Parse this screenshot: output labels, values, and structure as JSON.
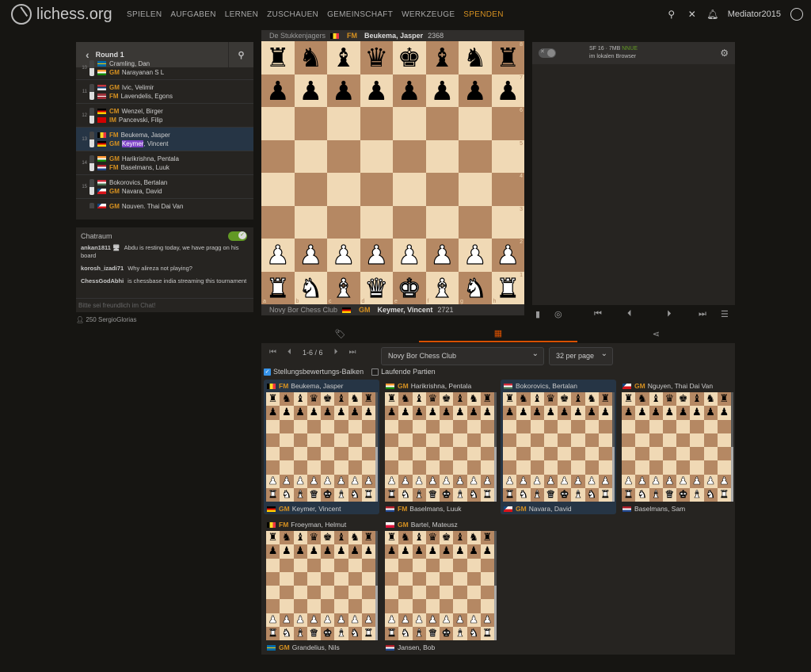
{
  "brand": {
    "name": "lichess.org"
  },
  "nav": [
    "SPIELEN",
    "AUFGABEN",
    "LERNEN",
    "ZUSCHAUEN",
    "GEMEINSCHAFT",
    "WERKZEUGE",
    "SPENDEN"
  ],
  "user": {
    "name": "Mediator2015"
  },
  "relay": {
    "round": "Round 1",
    "games": [
      {
        "num": "10",
        "white": {
          "title": "",
          "name": "Cramling, Dan",
          "flag": "se"
        },
        "black": {
          "title": "GM",
          "name": "Narayanan S L",
          "flag": "in"
        }
      },
      {
        "num": "11",
        "white": {
          "title": "GM",
          "name": "Ivic, Velimir",
          "flag": "rs"
        },
        "black": {
          "title": "FM",
          "name": "Lavendelis, Egons",
          "flag": "lv"
        }
      },
      {
        "num": "12",
        "white": {
          "title": "CM",
          "name": "Wenzel, Birger",
          "flag": "de"
        },
        "black": {
          "title": "IM",
          "name": "Pancevski, Filip",
          "flag": "mk"
        }
      },
      {
        "num": "13",
        "white": {
          "title": "FM",
          "name": "Beukema, Jasper",
          "flag": "be"
        },
        "black": {
          "title": "GM",
          "name_hl": "Keymer",
          "name_rest": ", Vincent",
          "flag": "de"
        },
        "selected": true
      },
      {
        "num": "14",
        "white": {
          "title": "GM",
          "name": "Harikrishna, Pentala",
          "flag": "in"
        },
        "black": {
          "title": "FM",
          "name": "Baselmans, Luuk",
          "flag": "nl"
        }
      },
      {
        "num": "15",
        "white": {
          "title": "",
          "name": "Bokorovics, Bertalan",
          "flag": "hu"
        },
        "black": {
          "title": "GM",
          "name": "Navara, David",
          "flag": "cz"
        }
      },
      {
        "num": "16",
        "white": {
          "title": "GM",
          "name": "Nguyen, Thai Dai Van",
          "flag": "cz"
        },
        "black": {
          "title": "",
          "name": "Baselmans, Sam",
          "flag": "nl"
        }
      }
    ]
  },
  "chat": {
    "title": "Chatraum",
    "messages": [
      {
        "user": "ankan1811 🖥",
        "text": "Abdu is resting today, we have pragg on his board"
      },
      {
        "user": "korosh_izadi71",
        "text": "Why alireza not playing?"
      },
      {
        "user": "ChessGodAbhi",
        "text": "is chessbase india streaming this tournament"
      }
    ],
    "placeholder": "Bitte sei freundlich im Chat!"
  },
  "spectators": {
    "count": "250",
    "names": "SergioGlorias"
  },
  "board": {
    "top": {
      "team": "De Stukkenjagers",
      "title": "FM",
      "name": "Beukema, Jasper",
      "rating": "2368",
      "flag": "be"
    },
    "bottom": {
      "team": "Novy Bor Chess Club",
      "title": "GM",
      "name": "Keymer, Vincent",
      "rating": "2721",
      "flag": "de"
    },
    "ranks": [
      "8",
      "7",
      "6",
      "5",
      "4",
      "3",
      "2",
      "1"
    ],
    "files": [
      "a",
      "b",
      "c",
      "d",
      "e",
      "f",
      "g",
      "h"
    ]
  },
  "engine": {
    "name": "SF 16 · 7MB",
    "nnue": "NNUE",
    "location": "im lokalen Browser"
  },
  "multiboard": {
    "pager": "1-6 / 6",
    "team_select": "Novy Bor Chess Club",
    "per_page": "32 per page",
    "eval_bars_label": "Stellungsbewertungs-Balken",
    "ongoing_label": "Laufende Partien",
    "games": [
      {
        "top": {
          "title": "FM",
          "name": "Beukema, Jasper",
          "flag": "be"
        },
        "bottom": {
          "title": "GM",
          "name": "Keymer, Vincent",
          "flag": "de"
        }
      },
      {
        "top": {
          "title": "GM",
          "name": "Harikrishna, Pentala",
          "flag": "in"
        },
        "bottom": {
          "title": "FM",
          "name": "Baselmans, Luuk",
          "flag": "nl"
        }
      },
      {
        "top": {
          "title": "",
          "name": "Bokorovics, Bertalan",
          "flag": "hu"
        },
        "bottom": {
          "title": "GM",
          "name": "Navara, David",
          "flag": "cz"
        }
      },
      {
        "top": {
          "title": "GM",
          "name": "Nguyen, Thai Dai Van",
          "flag": "cz"
        },
        "bottom": {
          "title": "",
          "name": "Baselmans, Sam",
          "flag": "nl"
        }
      },
      {
        "top": {
          "title": "FM",
          "name": "Froeyman, Helmut",
          "flag": "be"
        },
        "bottom": {
          "title": "GM",
          "name": "Grandelius, Nils",
          "flag": "se"
        }
      },
      {
        "top": {
          "title": "GM",
          "name": "Bartel, Mateusz",
          "flag": "pl"
        },
        "bottom": {
          "title": "",
          "name": "Jansen, Bob",
          "flag": "nl"
        }
      }
    ]
  }
}
